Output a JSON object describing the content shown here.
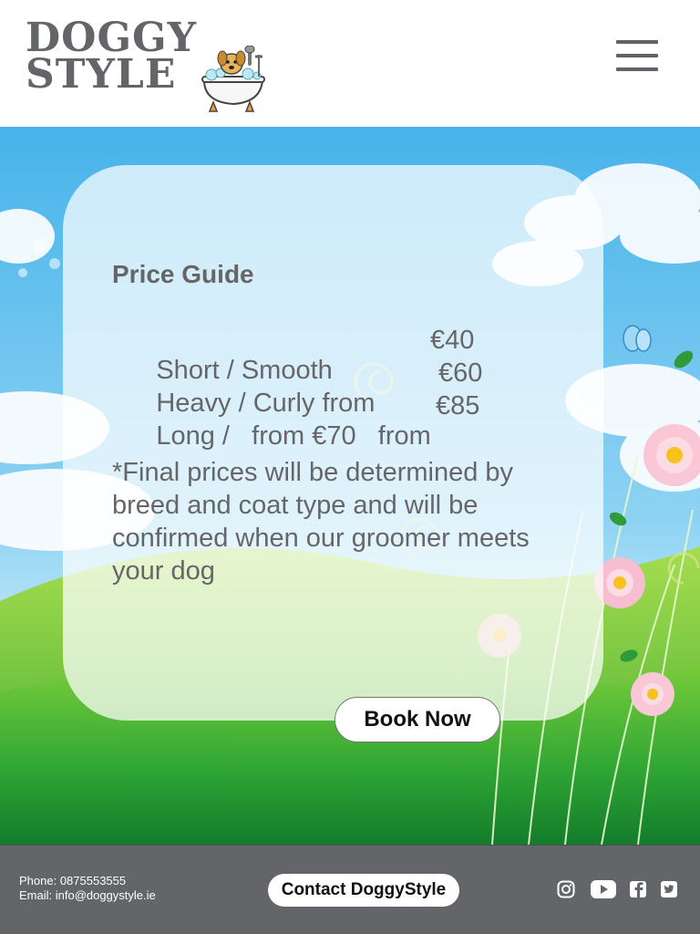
{
  "header": {
    "logo_line1": "DOGGY",
    "logo_line2": "STYLE"
  },
  "card": {
    "title": "Price Guide",
    "prices": [
      {
        "label": "Short / Smooth",
        "amount": "€40"
      },
      {
        "label": "Heavy / Curly from",
        "amount": "€60"
      },
      {
        "label": "Long /   from €70   from",
        "amount": "€85"
      }
    ],
    "note": "*Final prices will be determined by breed and coat type and will be confirmed when our groomer meets your dog"
  },
  "book_button": "Book Now",
  "footer": {
    "phone": "Phone: 0875553555",
    "email": "Email: info@doggystyle.ie",
    "contact_button": "Contact DoggyStyle",
    "social_icons": [
      "instagram-icon",
      "youtube-icon",
      "facebook-icon",
      "twitter-icon"
    ]
  },
  "colors": {
    "logo_gray": "#636569",
    "footer_bg": "#636569",
    "sky": "#4fb8ea",
    "grass": "#3aa832"
  }
}
